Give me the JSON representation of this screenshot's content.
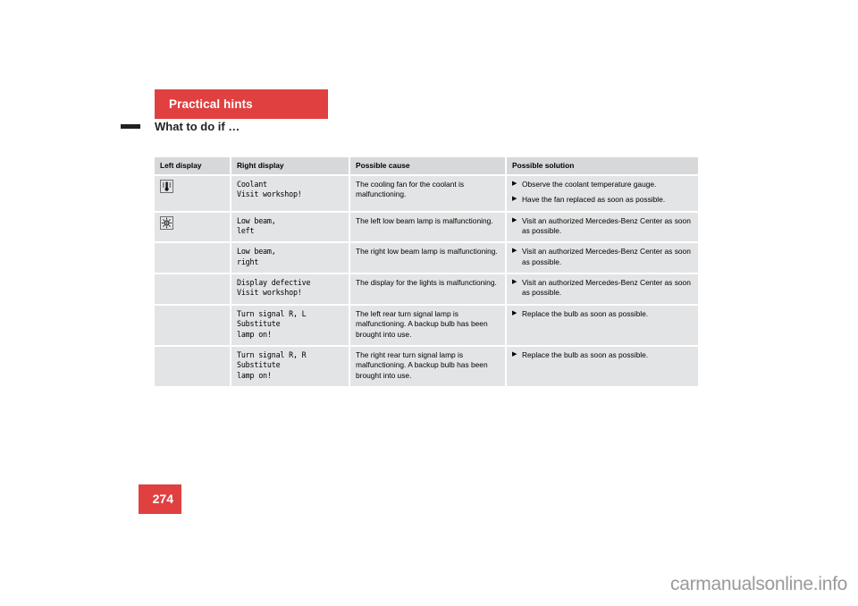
{
  "header": {
    "title": "Practical hints",
    "subtitle": "What to do if …"
  },
  "page_number": "274",
  "watermark": "carmanualsonline.info",
  "table": {
    "columns": [
      "Left display",
      "Right display",
      "Possible cause",
      "Possible solution"
    ],
    "rows": [
      {
        "icon": "coolant-temperature-icon",
        "right_display": "Coolant\nVisit workshop!",
        "cause": "The cooling fan for the coolant is malfunctioning.",
        "solutions": [
          "Observe the coolant temperature gauge.",
          "Have the fan replaced as soon as possible."
        ]
      },
      {
        "icon": "low-beam-lamp-icon",
        "right_display": "Low beam,\nleft",
        "cause": "The left low beam lamp is malfunctioning.",
        "solutions": [
          "Visit an authorized Mercedes-Benz Center as soon as possible."
        ]
      },
      {
        "icon": "",
        "right_display": "Low beam,\nright",
        "cause": "The right low beam lamp is malfunctioning.",
        "solutions": [
          "Visit an authorized Mercedes-Benz Center as soon as possible."
        ]
      },
      {
        "icon": "",
        "right_display": "Display defective\nVisit workshop!",
        "cause": "The display for the lights is malfunctioning.",
        "solutions": [
          "Visit an authorized Mercedes-Benz Center as soon as possible."
        ]
      },
      {
        "icon": "",
        "right_display": "Turn signal R, L\nSubstitute\nlamp on!",
        "cause": "The left rear turn signal lamp is malfunctioning. A backup bulb has been brought into use.",
        "solutions": [
          "Replace the bulb as soon as possible."
        ]
      },
      {
        "icon": "",
        "right_display": "Turn signal R, R\nSubstitute\nlamp on!",
        "cause": "The right rear turn signal lamp is malfunctioning. A backup bulb has been brought into use.",
        "solutions": [
          "Replace the bulb as soon as possible."
        ]
      }
    ]
  },
  "colors": {
    "accent_red": "#e0403f",
    "table_header_gray": "#d7d8d9",
    "table_cell_gray": "#e3e4e5",
    "mono_text_gray": "#8c8d8f"
  }
}
